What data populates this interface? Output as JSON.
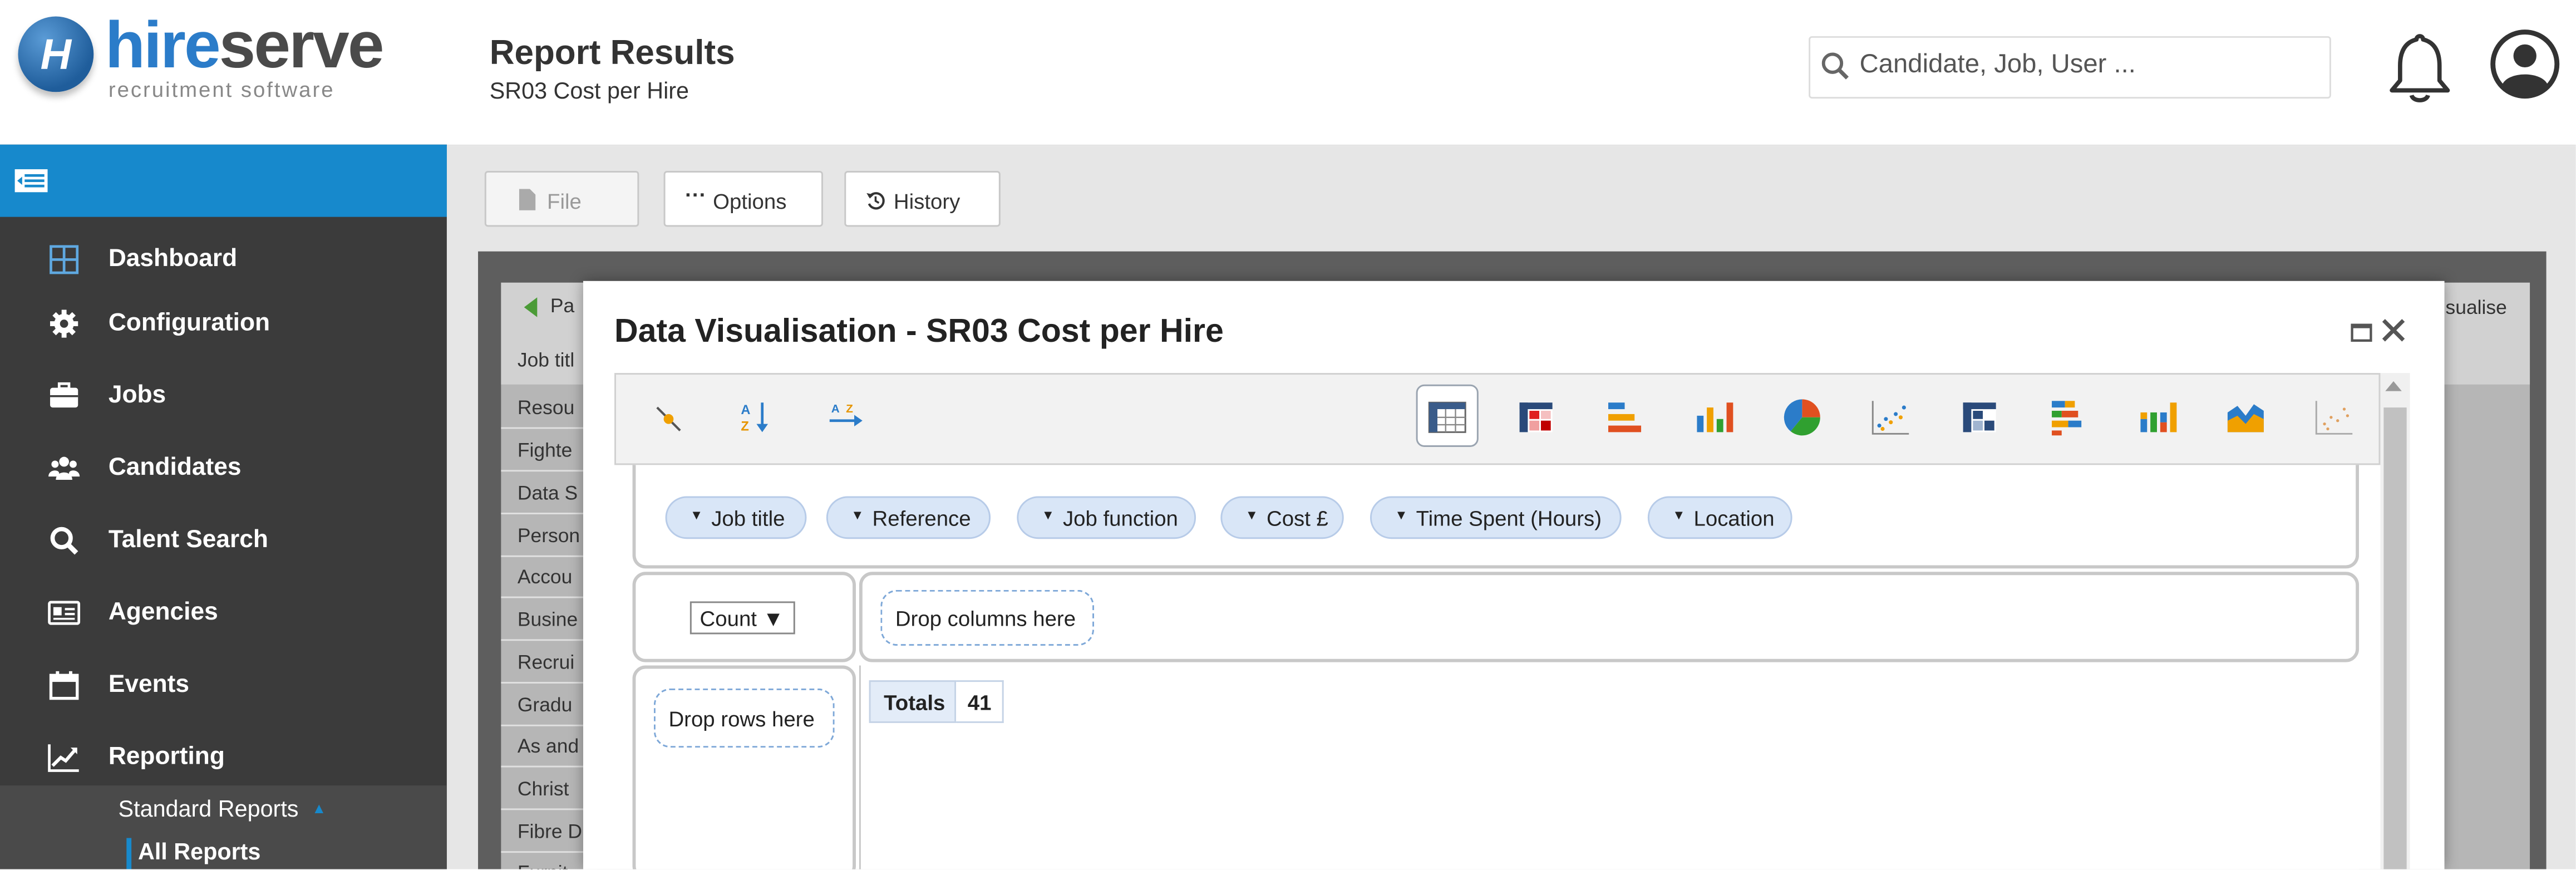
{
  "header": {
    "logo_letter": "H",
    "logo_word_part1": "hire",
    "logo_word_part2": "serve",
    "logo_tagline": "recruitment software",
    "page_title": "Report Results",
    "page_subtitle": "SR03 Cost per Hire",
    "search": {
      "placeholder": "Candidate, Job, User ..."
    },
    "icons": [
      "search-icon",
      "bell-icon",
      "user-account-icon"
    ]
  },
  "sidebar": {
    "items": [
      {
        "label": "Dashboard",
        "icon": "grid-icon"
      },
      {
        "label": "Configuration",
        "icon": "gear-icon"
      },
      {
        "label": "Jobs",
        "icon": "briefcase-icon"
      },
      {
        "label": "Candidates",
        "icon": "people-icon"
      },
      {
        "label": "Talent Search",
        "icon": "search-icon"
      },
      {
        "label": "Agencies",
        "icon": "id-card-icon"
      },
      {
        "label": "Events",
        "icon": "calendar-icon"
      },
      {
        "label": "Reporting",
        "icon": "line-chart-icon"
      }
    ],
    "submenu": {
      "standard_reports": "Standard Reports",
      "all_reports": "All Reports"
    }
  },
  "toolbar": {
    "file_label": "File",
    "options_label": "Options",
    "history_label": "History"
  },
  "background_panel": {
    "back_label": "Pa",
    "job_title_header": "Job titl",
    "visualise_label": "isualise",
    "rows": [
      "Resou",
      "Fighte",
      "Data S",
      "Person",
      "Accou",
      "Busine",
      "Recrui",
      "Gradu",
      "As and",
      "Christ",
      "Fibre D",
      "Furnit"
    ]
  },
  "modal": {
    "title": "Data Visualisation - SR03 Cost per Hire",
    "tools": [
      "clear-icon",
      "sort-az-icon",
      "sort-direction-icon"
    ],
    "renderers": [
      "table-icon",
      "heatmap-icon",
      "horizontal-bar-icon",
      "bar-chart-icon",
      "pie-chart-icon",
      "scatter-chart-icon",
      "row-heatmap-icon",
      "stacked-bar-icon",
      "stacked-column-icon",
      "area-chart-icon",
      "dot-chart-icon"
    ],
    "fields": [
      "Job title",
      "Reference",
      "Job function",
      "Cost £",
      "Time Spent (Hours)",
      "Location"
    ],
    "aggregator": "Count ▼",
    "drop_columns": "Drop columns here",
    "drop_rows": "Drop rows here",
    "totals_label": "Totals",
    "totals_value": "41"
  },
  "colors": {
    "accent": "#1789cc",
    "sidebar": "#3b3b3b",
    "brand_blue": "#2b7cc9"
  }
}
